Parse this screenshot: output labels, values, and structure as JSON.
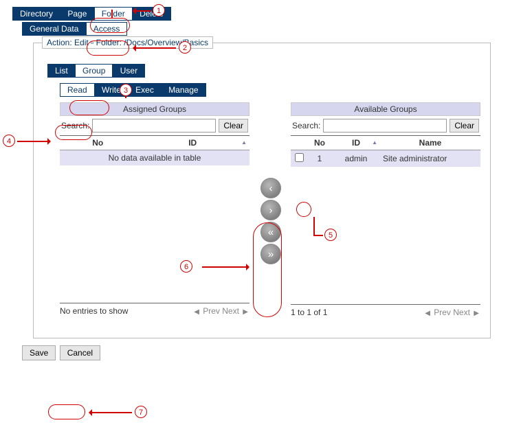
{
  "topTabs": {
    "directory": "Directory",
    "page": "Page",
    "folder": "Folder",
    "delete": "Delete"
  },
  "subTabs": {
    "generalData": "General Data",
    "access": "Access"
  },
  "legend": "Action: Edit ▫ Folder: /Docs/Overview/Basics",
  "innerTabs": {
    "list": "List",
    "group": "Group",
    "user": "User"
  },
  "permTabs": {
    "read": "Read",
    "write": "Write",
    "exec": "Exec",
    "manage": "Manage"
  },
  "left": {
    "title": "Assigned Groups",
    "searchLabel": "Search:",
    "searchPlaceholder": "",
    "clear": "Clear",
    "columns": {
      "no": "No",
      "id": "ID"
    },
    "empty": "No data available in table",
    "footer": "No entries to show",
    "prev": "Prev",
    "next": "Next"
  },
  "right": {
    "title": "Available Groups",
    "searchLabel": "Search:",
    "searchPlaceholder": "",
    "clear": "Clear",
    "columns": {
      "no": "No",
      "id": "ID",
      "name": "Name"
    },
    "rows": [
      {
        "no": "1",
        "id": "admin",
        "name": "Site administrator"
      }
    ],
    "footer": "1 to 1 of 1",
    "prev": "Prev",
    "next": "Next"
  },
  "transferIcons": {
    "left": "‹",
    "right": "›",
    "allLeft": "«",
    "allRight": "»"
  },
  "buttons": {
    "save": "Save",
    "cancel": "Cancel"
  },
  "annotations": {
    "a1": "1",
    "a2": "2",
    "a3": "3",
    "a4": "4",
    "a5": "5",
    "a6": "6",
    "a7": "7"
  }
}
